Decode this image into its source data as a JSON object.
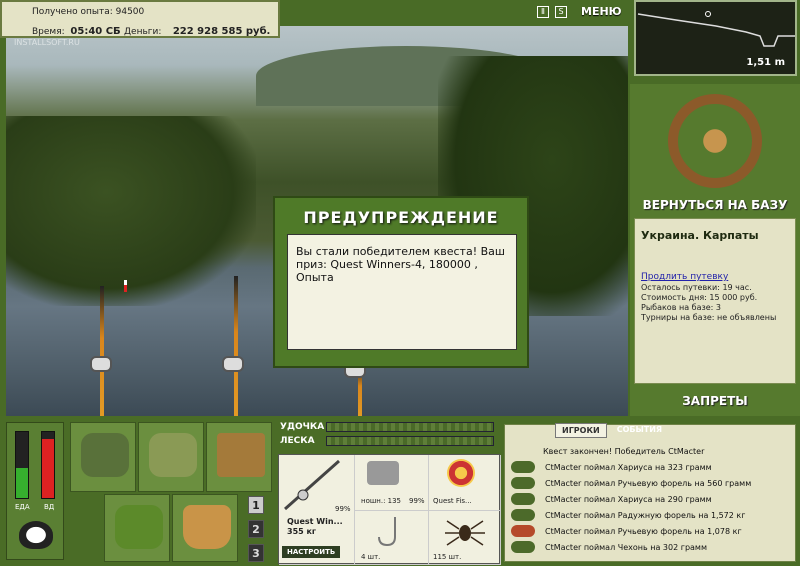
{
  "header": {
    "exp_label": "Получено опыта:",
    "exp_value": "94500",
    "time_label": "Время:",
    "time_value": "05:40 СБ",
    "money_label": "Деньги:",
    "money_value": "222 928 585 руб.",
    "menu_label": "МЕНЮ",
    "pause_icon": "Ⅱ",
    "sound_icon": "S"
  },
  "watermark": "INSTALLSOFT.RU",
  "depth": {
    "value": "1,51 m"
  },
  "right_panel": {
    "return_label": "ВЕРНУТЬСЯ НА БАЗУ",
    "base_title": "Украина. Карпаты",
    "extend_link": "Продлить путевку",
    "lines": [
      "Осталось путевки: 19 час.",
      "Стоимость дня: 15 000 руб.",
      "Рыбаков на базе: 3",
      "Турниры на базе: не объявлены"
    ],
    "bans_label": "ЗАПРЕТЫ"
  },
  "dialog": {
    "title": "ПРЕДУПРЕЖДЕНИЕ",
    "message": "Вы стали победителем квеста! Ваш приз: Quest Winners-4, 180000 , Опыта"
  },
  "gauges": {
    "energy_label": "ЕДА",
    "thirst_label": "ВД",
    "energy_level": 0.45,
    "thirst_level": 0.9
  },
  "inventory_tabs": [
    "1",
    "2",
    "3"
  ],
  "rod_controls": {
    "rod_label": "УДОЧКА",
    "line_label": "ЛЕСКА"
  },
  "tackle": {
    "rod_percent": "99%",
    "rod_name": "Quest Win...",
    "rod_weight": "355 кг",
    "configure_label": "НАСТРОИТЬ",
    "reel_label": "ношн.: 135",
    "reel_percent": "99%",
    "line_name": "Quest Fis...",
    "hook_count": "4 шт.",
    "bait_count": "115 шт."
  },
  "log": {
    "tab_players": "ИГРОКИ",
    "tab_events": "СОБЫТИЯ",
    "header_line": "Квест закончен! Победитель CtMacter",
    "entries": [
      "CtMacter поймал Хариуса на 323 грамм",
      "CtMacter поймал Ручьевую форель на 560 грамм",
      "CtMacter поймал Хариуса на 290 грамм",
      "CtMacter поймал Радужную форель на 1,572 кг",
      "CtMacter поймал Ручьевую форель на 1,078 кг",
      "CtMacter поймал Чехонь на 302 грамм"
    ]
  },
  "colors": {
    "panel_green": "#496b26",
    "paper": "#e4e3c6",
    "rod_orange": "#e39a25"
  }
}
